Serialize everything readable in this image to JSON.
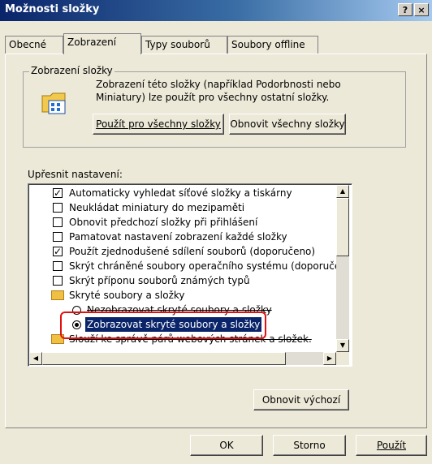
{
  "window": {
    "title": "Možnosti složky",
    "help_label": "?",
    "close_label": "×"
  },
  "tabs": [
    {
      "label": "Obecné"
    },
    {
      "label": "Zobrazení"
    },
    {
      "label": "Typy souborů"
    },
    {
      "label": "Soubory offline"
    }
  ],
  "folder_views": {
    "legend": "Zobrazení složky",
    "description": "Zobrazení této složky (například Podorbnosti nebo Miniatury) lze použít pro všechny ostatní složky.",
    "apply_all": "Použít pro všechny složky",
    "reset_all": "Obnovit všechny složky"
  },
  "advanced": {
    "label": "Upřesnit nastavení:",
    "items": [
      {
        "type": "checkbox",
        "checked": true,
        "label": "Automaticky vyhledat síťové složky a tiskárny"
      },
      {
        "type": "checkbox",
        "checked": false,
        "label": "Neukládat miniatury do mezipaměti"
      },
      {
        "type": "checkbox",
        "checked": false,
        "label": "Obnovit předchozí složky při přihlášení"
      },
      {
        "type": "checkbox",
        "checked": false,
        "label": "Pamatovat nastavení zobrazení každé složky"
      },
      {
        "type": "checkbox",
        "checked": true,
        "label": "Použít zjednodušené sdílení souborů (doporučeno)"
      },
      {
        "type": "checkbox",
        "checked": false,
        "label": "Skrýt chráněné soubory operačního systému (doporučer"
      },
      {
        "type": "checkbox",
        "checked": false,
        "label": "Skrýt příponu souborů známých typů"
      },
      {
        "type": "folder",
        "label": "Skryté soubory a složky"
      },
      {
        "type": "radio",
        "selected": false,
        "label": "Nezobrazovat skryté soubory a složky"
      },
      {
        "type": "radio",
        "selected": true,
        "label": "Zobrazovat skryté soubory a složky"
      },
      {
        "type": "folder",
        "label": "Slouží ke správě párů webových stránek a složek."
      }
    ]
  },
  "restore_defaults": "Obnovit výchozí",
  "footer": {
    "ok": "OK",
    "cancel": "Storno",
    "apply": "Použít"
  },
  "colors": {
    "titlebar": "#0a246a",
    "highlight": "#e41010",
    "selection": "#0a246a"
  }
}
